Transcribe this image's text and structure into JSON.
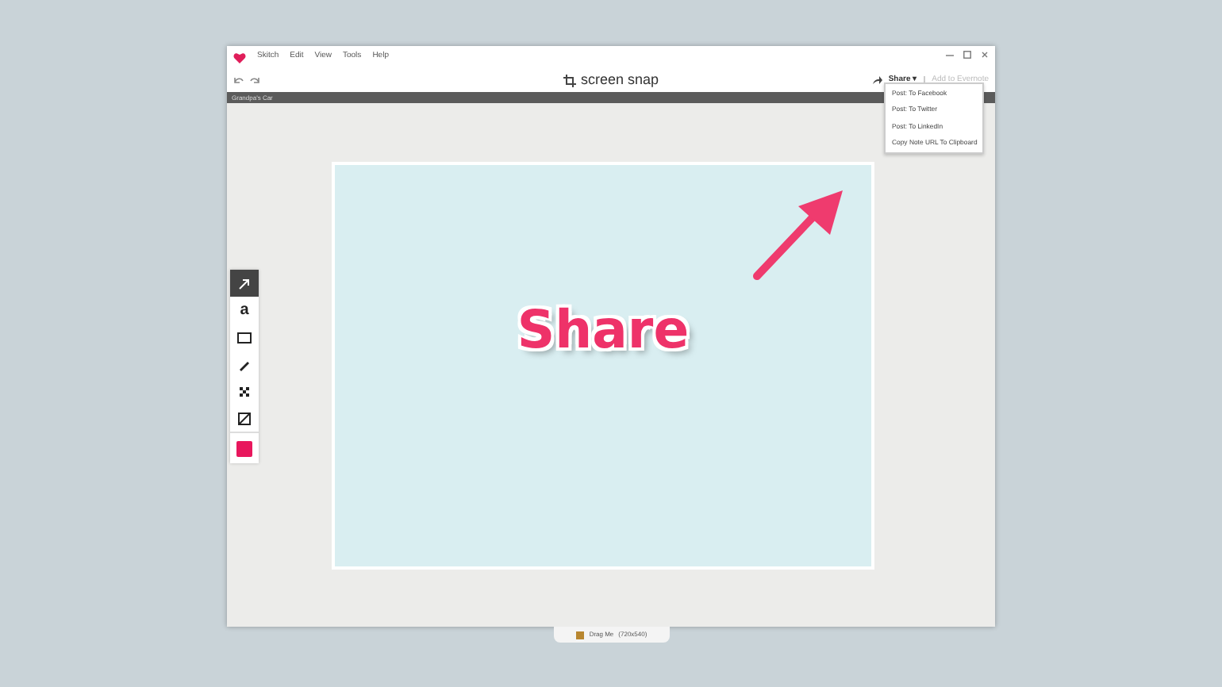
{
  "window": {
    "menu": [
      "Skitch",
      "Edit",
      "View",
      "Tools",
      "Help"
    ],
    "title": "screen snap"
  },
  "toolbar": {
    "share": {
      "label": "Share ▾",
      "expanded": true
    },
    "evernote": {
      "label": "Add to Evernote",
      "disabled": true
    }
  },
  "share_menu": [
    "Post: To Facebook",
    "Post: To Twitter",
    "Post: To LinkedIn",
    "Copy Note URL To Clipboard"
  ],
  "note_bar": {
    "title": "Grandpa's Car"
  },
  "tools": [
    {
      "kind": "arrow",
      "selected": true
    },
    {
      "kind": "text",
      "selected": false,
      "label": "a"
    },
    {
      "kind": "rect",
      "selected": false
    },
    {
      "kind": "pen",
      "selected": false
    },
    {
      "kind": "pixelate",
      "selected": false
    },
    {
      "kind": "crop",
      "selected": false
    },
    {
      "kind": "color",
      "selected": false,
      "color": "#e8175d"
    }
  ],
  "canvas": {
    "sticker": "Share"
  },
  "drag_tab": {
    "label": "Drag Me",
    "size": "(720x540)"
  }
}
